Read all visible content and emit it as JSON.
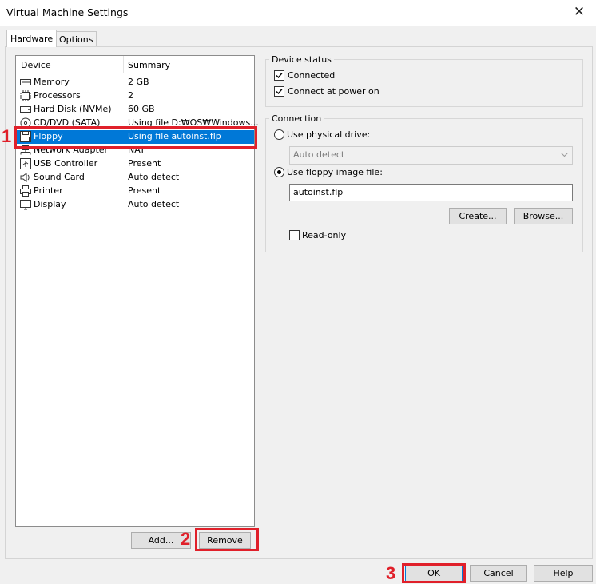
{
  "window": {
    "title": "Virtual Machine Settings",
    "close": "✕"
  },
  "tabs": [
    {
      "label": "Hardware",
      "active": true
    },
    {
      "label": "Options",
      "active": false
    }
  ],
  "device_list": {
    "columns": {
      "device": "Device",
      "summary": "Summary"
    },
    "items": [
      {
        "icon": "memory-icon",
        "name": "Memory",
        "summary": "2 GB",
        "selected": false
      },
      {
        "icon": "processor-icon",
        "name": "Processors",
        "summary": "2",
        "selected": false
      },
      {
        "icon": "hard-disk-icon",
        "name": "Hard Disk (NVMe)",
        "summary": "60 GB",
        "selected": false
      },
      {
        "icon": "cd-dvd-icon",
        "name": "CD/DVD (SATA)",
        "summary": "Using file D:₩OS₩Windows...",
        "selected": false
      },
      {
        "icon": "floppy-icon",
        "name": "Floppy",
        "summary": "Using file autoinst.flp",
        "selected": true
      },
      {
        "icon": "network-adapter-icon",
        "name": "Network Adapter",
        "summary": "NAT",
        "selected": false
      },
      {
        "icon": "usb-controller-icon",
        "name": "USB Controller",
        "summary": "Present",
        "selected": false
      },
      {
        "icon": "sound-card-icon",
        "name": "Sound Card",
        "summary": "Auto detect",
        "selected": false
      },
      {
        "icon": "printer-icon",
        "name": "Printer",
        "summary": "Present",
        "selected": false
      },
      {
        "icon": "display-icon",
        "name": "Display",
        "summary": "Auto detect",
        "selected": false
      }
    ]
  },
  "list_buttons": {
    "add": "Add...",
    "remove": "Remove"
  },
  "device_status": {
    "title": "Device status",
    "connected": {
      "label": "Connected",
      "checked": true
    },
    "connect_at_power_on": {
      "label": "Connect at power on",
      "checked": true
    }
  },
  "connection": {
    "title": "Connection",
    "physical_drive": {
      "label": "Use physical drive:",
      "selected": false
    },
    "drive_select": {
      "value": "Auto detect",
      "enabled": false
    },
    "floppy_image": {
      "label": "Use floppy image file:",
      "selected": true
    },
    "image_file": {
      "value": "autoinst.flp"
    },
    "create_button": "Create...",
    "browse_button": "Browse...",
    "read_only": {
      "label": "Read-only",
      "checked": false
    }
  },
  "footer": {
    "ok": "OK",
    "cancel": "Cancel",
    "help": "Help"
  },
  "annotations": {
    "step1": "1",
    "step2": "2",
    "step3": "3"
  },
  "colors": {
    "selection": "#0078d7",
    "annotation": "#e0202a",
    "window_bg": "#f0f0f0"
  }
}
